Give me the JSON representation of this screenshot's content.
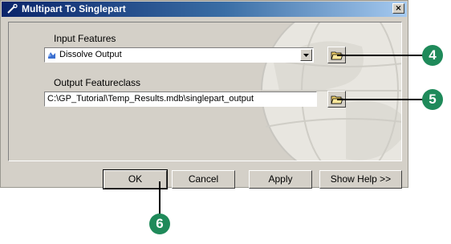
{
  "window": {
    "title": "Multipart To Singlepart",
    "close_label": "×"
  },
  "form": {
    "input_label": "Input Features",
    "input_value": "Dissolve Output",
    "output_label": "Output Featureclass",
    "output_value": "C:\\GP_Tutorial\\Temp_Results.mdb\\singlepart_output"
  },
  "buttons": {
    "ok": "OK",
    "cancel": "Cancel",
    "apply": "Apply",
    "help": "Show Help >>"
  },
  "callouts": {
    "input_browse": "4",
    "output_browse": "5",
    "ok_button": "6"
  },
  "colors": {
    "callout": "#1f8a5a",
    "titlebar_start": "#0a246a",
    "titlebar_end": "#a6caf0"
  },
  "icons": {
    "title": "tool-wrench-icon",
    "layer": "feature-layer-icon",
    "browse": "open-folder-icon",
    "dropdown": "chevron-down-icon"
  }
}
